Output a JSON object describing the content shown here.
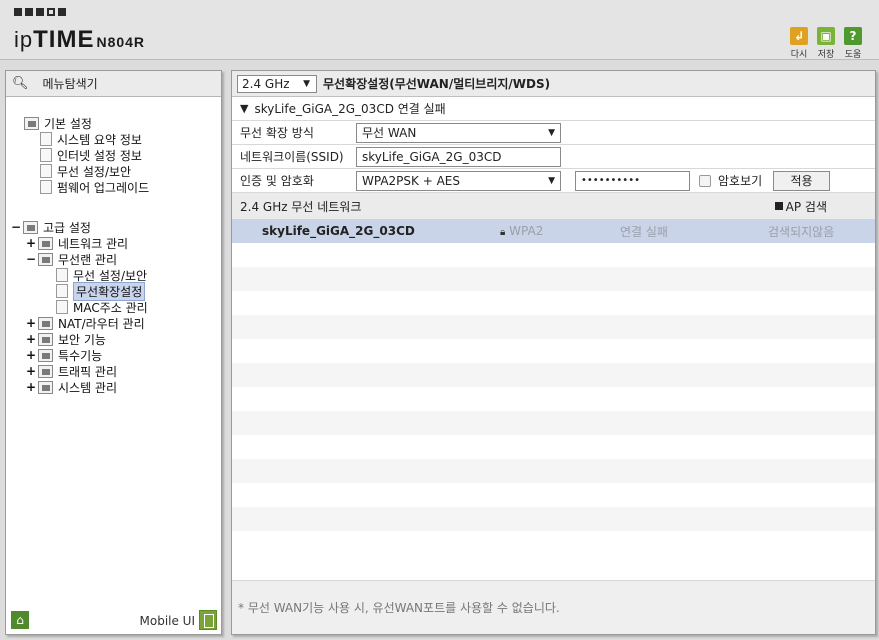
{
  "header": {
    "logo_prefix": "ip",
    "logo_main": "TIME",
    "model": "N804R",
    "buttons": [
      {
        "label": "다시",
        "icon": "back-icon",
        "color": "#e0a020"
      },
      {
        "label": "저장",
        "icon": "save-icon",
        "color": "#7bb23a"
      },
      {
        "label": "도움",
        "icon": "help-icon",
        "color": "#4e9a2e"
      }
    ]
  },
  "sidebar": {
    "title": "메뉴탐색기",
    "basic": {
      "label": "기본 설정",
      "items": [
        "시스템 요약 정보",
        "인터넷 설정 정보",
        "무선 설정/보안",
        "펌웨어 업그레이드"
      ]
    },
    "advanced": {
      "label": "고급 설정",
      "groups": {
        "network": "네트워크 관리",
        "wireless": "무선랜 관리",
        "wireless_children": [
          "무선 설정/보안",
          "무선확장설정",
          "MAC주소 관리"
        ],
        "nat": "NAT/라우터 관리",
        "security": "보안 기능",
        "special": "특수기능",
        "traffic": "트래픽 관리",
        "system": "시스템 관리"
      }
    },
    "footer": {
      "mobile_label": "Mobile UI"
    }
  },
  "main": {
    "band": "2.4 GHz",
    "title": "무선확장설정(무선WAN/멀티브리지/WDS)",
    "status": "skyLife_GiGA_2G_03CD 연결 실패",
    "form": {
      "mode_label": "무선 확장 방식",
      "mode_value": "무선 WAN",
      "ssid_label": "네트워크이름(SSID)",
      "ssid_value": "skyLife_GiGA_2G_03CD",
      "auth_label": "인증 및 암호화",
      "auth_value": "WPA2PSK + AES",
      "password_value": "••••••••••",
      "show_password_label": "암호보기",
      "apply_label": "적용"
    },
    "network": {
      "title": "2.4 GHz 무선 네트워크",
      "ap_search_label": "AP 검색",
      "rows": [
        {
          "ssid": "skyLife_GiGA_2G_03CD",
          "security": "WPA2",
          "status": "연결 실패",
          "scan": "검색되지않음"
        }
      ]
    },
    "notice": "* 무선 WAN기능 사용 시, 유선WAN포트를 사용할 수 없습니다."
  }
}
